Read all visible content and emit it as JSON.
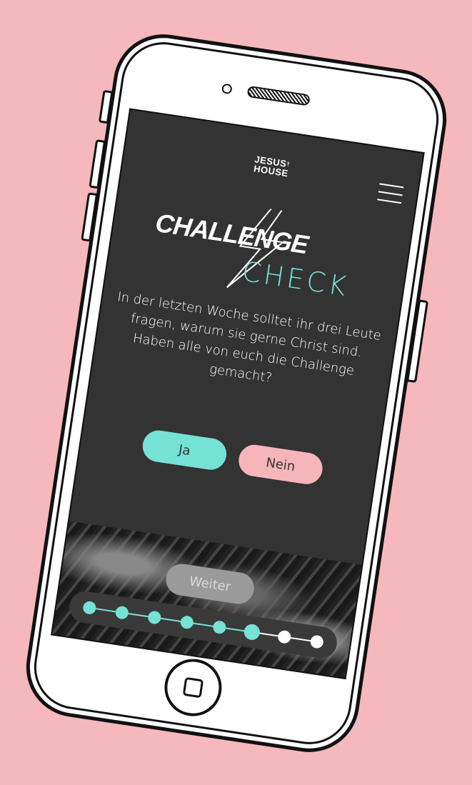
{
  "header": {
    "logo_line1": "JESUS",
    "logo_line2": "HOUSE"
  },
  "title": {
    "main": "CHALLENGE",
    "sub": "CHECK"
  },
  "question": "In der letzten Woche solltet ihr drei Leute fragen, warum sie gerne Christ sind. Haben alle von euch die Challenge gemacht?",
  "answers": {
    "yes_label": "Ja",
    "no_label": "Nein"
  },
  "continue_label": "Weiter",
  "progress": {
    "total_steps": 8,
    "completed_steps": 6
  },
  "colors": {
    "background": "#f5b8bc",
    "screen": "#333333",
    "accent_teal": "#76e2d6",
    "accent_pink": "#f6b6b9",
    "inactive_dot": "#ffffff"
  }
}
